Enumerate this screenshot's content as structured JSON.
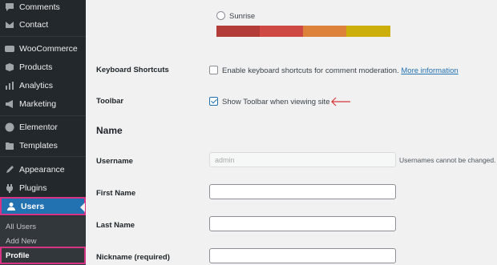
{
  "sidebar": {
    "items": [
      {
        "label": "Comments",
        "icon": "comments-icon"
      },
      {
        "label": "Contact",
        "icon": "mail-icon"
      },
      {
        "label": "WooCommerce",
        "icon": "woocommerce-icon"
      },
      {
        "label": "Products",
        "icon": "products-icon"
      },
      {
        "label": "Analytics",
        "icon": "analytics-icon"
      },
      {
        "label": "Marketing",
        "icon": "marketing-icon"
      },
      {
        "label": "Elementor",
        "icon": "elementor-icon"
      },
      {
        "label": "Templates",
        "icon": "templates-icon"
      },
      {
        "label": "Appearance",
        "icon": "appearance-icon"
      },
      {
        "label": "Plugins",
        "icon": "plugins-icon"
      },
      {
        "label": "Users",
        "icon": "users-icon"
      }
    ],
    "submenu": [
      {
        "label": "All Users"
      },
      {
        "label": "Add New"
      },
      {
        "label": "Profile"
      }
    ]
  },
  "color_scheme": {
    "option_label": "Sunrise",
    "swatches": [
      "#b43c38",
      "#cf4944",
      "#dd823b",
      "#ccaf0b"
    ]
  },
  "keyboard_shortcuts": {
    "label": "Keyboard Shortcuts",
    "checkbox_text": "Enable keyboard shortcuts for comment moderation.",
    "link_text": "More information",
    "checked": false
  },
  "toolbar": {
    "label": "Toolbar",
    "checkbox_text": "Show Toolbar when viewing site",
    "checked": true,
    "arrow_color": "#d63638"
  },
  "name_section": {
    "title": "Name",
    "username_label": "Username",
    "username_value": "admin",
    "username_hint": "Usernames cannot be changed.",
    "first_name_label": "First Name",
    "first_name_value": "",
    "last_name_label": "Last Name",
    "last_name_value": "",
    "nickname_label": "Nickname (required)",
    "nickname_value": ""
  }
}
